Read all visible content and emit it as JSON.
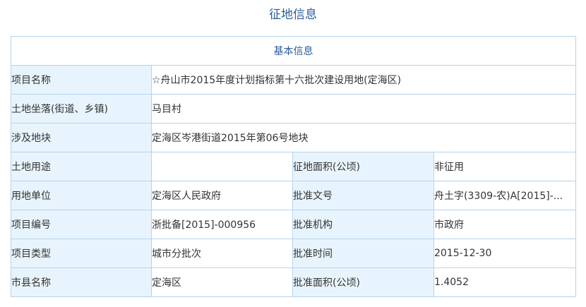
{
  "page": {
    "title": "征地信息"
  },
  "table": {
    "section_title": "基本信息",
    "project_name_label": "项目名称",
    "project_name": "☆舟山市2015年度计划指标第十六批次建设用地(定海区)",
    "location_label": "土地坐落(街道、乡镇)",
    "location": "马目村",
    "parcels_label": "涉及地块",
    "parcels": "定海区岑港街道2015年第06号地块",
    "rows": [
      {
        "l1": "土地用途",
        "v1": "",
        "l2": "征地面积(公顷)",
        "v2": "非征用"
      },
      {
        "l1": "用地单位",
        "v1": "定海区人民政府",
        "l2": "批准文号",
        "v2": "舟土字(3309-农)A[2015]-..."
      },
      {
        "l1": "项目编号",
        "v1": "浙批备[2015]-000956",
        "l2": "批准机构",
        "v2": "市政府"
      },
      {
        "l1": "项目类型",
        "v1": "城市分批次",
        "l2": "批准时间",
        "v2": "2015-12-30"
      },
      {
        "l1": "市县名称",
        "v1": "定海区",
        "l2": "批准面积(公顷)",
        "v2": "1.4052"
      }
    ]
  }
}
